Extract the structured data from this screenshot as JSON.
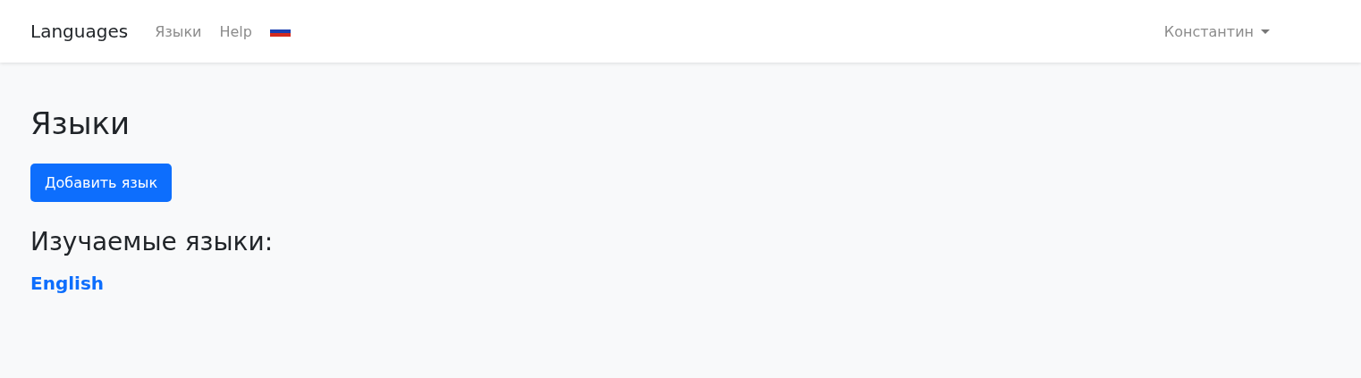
{
  "navbar": {
    "brand": "Languages",
    "links": [
      {
        "label": "Языки"
      },
      {
        "label": "Help"
      }
    ],
    "user_menu": {
      "label": "Константин",
      "expanded": false
    }
  },
  "page": {
    "title": "Языки",
    "add_button": "Добавить язык",
    "subtitle": "Изучаемые языки:",
    "languages": [
      {
        "label": "English"
      }
    ]
  }
}
